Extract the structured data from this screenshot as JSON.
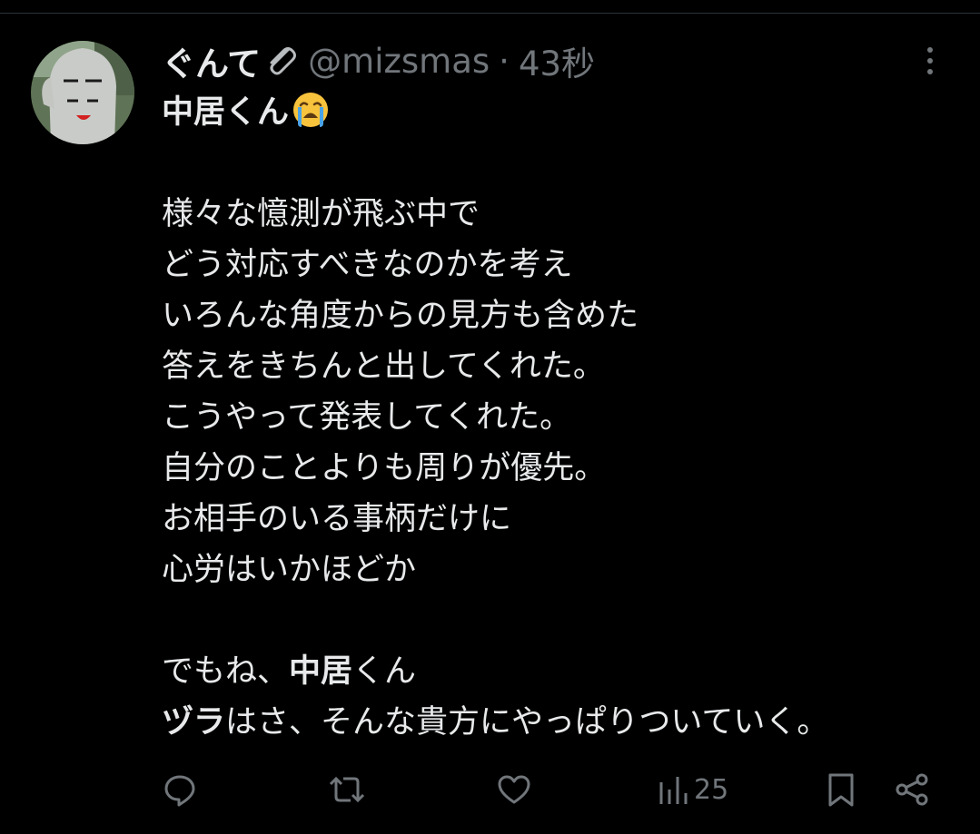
{
  "tweet": {
    "display_name": "ぐんて",
    "handle": "@mizsmas",
    "separator": "·",
    "time": "43秒",
    "lines": [
      {
        "parts": [
          {
            "text": "中居くん",
            "bold": true
          }
        ],
        "emoji": "loudly-crying-face"
      },
      {
        "parts": []
      },
      {
        "parts": [
          {
            "text": "様々な憶測が飛ぶ中で"
          }
        ]
      },
      {
        "parts": [
          {
            "text": "どう対応すべきなのかを考え"
          }
        ]
      },
      {
        "parts": [
          {
            "text": "いろんな角度からの見方も含めた"
          }
        ]
      },
      {
        "parts": [
          {
            "text": "答えをきちんと出してくれた。"
          }
        ]
      },
      {
        "parts": [
          {
            "text": "こうやって発表してくれた。"
          }
        ]
      },
      {
        "parts": [
          {
            "text": "自分のことよりも周りが優先。"
          }
        ]
      },
      {
        "parts": [
          {
            "text": "お相手のいる事柄だけに"
          }
        ]
      },
      {
        "parts": [
          {
            "text": "心労はいかほどか"
          }
        ]
      },
      {
        "parts": []
      },
      {
        "parts": [
          {
            "text": "でもね、"
          },
          {
            "text": "中居",
            "bold": true
          },
          {
            "text": "くん"
          }
        ]
      },
      {
        "parts": [
          {
            "text": "ヅラ",
            "bold": true
          },
          {
            "text": "はさ、そんな貴方にやっぱりついていく。"
          }
        ]
      }
    ],
    "views": "25"
  },
  "icons": {
    "name_suffix": "paperclip-icon",
    "more": "more-vertical-icon",
    "reply": "reply-icon",
    "retweet": "retweet-icon",
    "like": "heart-icon",
    "views": "analytics-icon",
    "bookmark": "bookmark-icon",
    "share": "share-icon"
  },
  "colors": {
    "background": "#000000",
    "text": "#e7e9ea",
    "secondary": "#71767b"
  }
}
